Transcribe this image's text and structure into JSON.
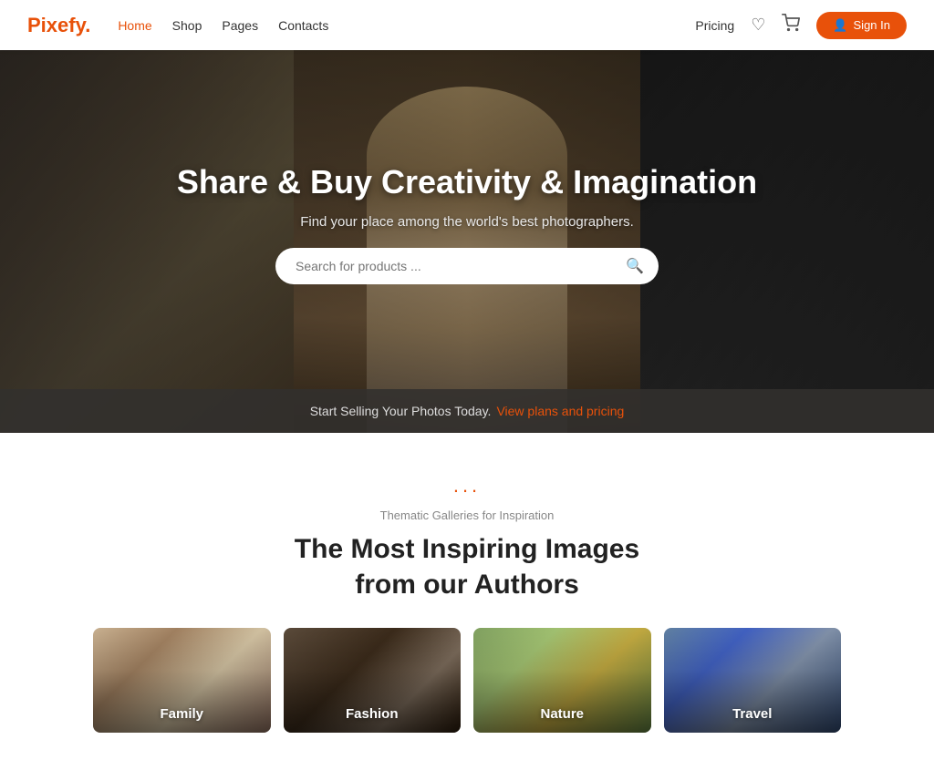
{
  "brand": {
    "name": "Pixefy",
    "dot": "."
  },
  "navbar": {
    "links": [
      {
        "label": "Home",
        "active": true
      },
      {
        "label": "Shop",
        "active": false
      },
      {
        "label": "Pages",
        "active": false
      },
      {
        "label": "Contacts",
        "active": false
      }
    ],
    "pricing_label": "Pricing",
    "signin_label": "Sign In"
  },
  "hero": {
    "title": "Share & Buy Creativity & Imagination",
    "subtitle": "Find your place among the world's best photographers.",
    "search_placeholder": "Search for products ...",
    "bottom_text": "Start Selling Your Photos Today.",
    "bottom_link": "View plans and pricing"
  },
  "gallery_section": {
    "dots": "...",
    "subtitle": "Thematic Galleries for Inspiration",
    "title": "The Most Inspiring Images\nfrom our Authors",
    "cards": [
      {
        "label": "Family",
        "theme": "family"
      },
      {
        "label": "Fashion",
        "theme": "fashion"
      },
      {
        "label": "Nature",
        "theme": "nature"
      },
      {
        "label": "Travel",
        "theme": "travel"
      }
    ]
  }
}
